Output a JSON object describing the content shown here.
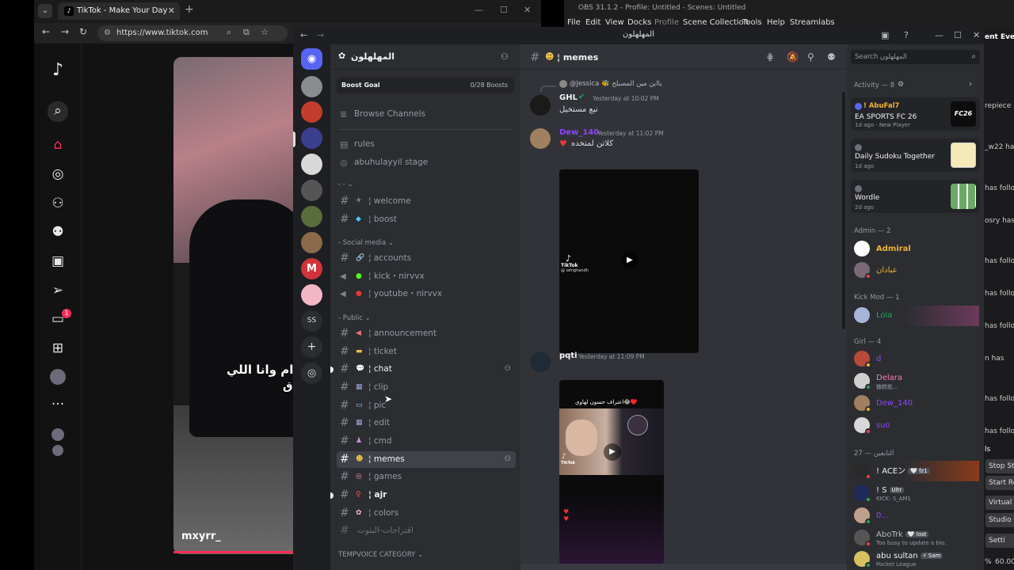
{
  "colors": {
    "tiktok_red": "#fe2c55",
    "discord_bg": "#313338",
    "discord_sidebar": "#2b2d31",
    "discord_dark": "#1e1f22",
    "selected_channel": "#404249",
    "admin_gold": "#f0b232",
    "kickmod_green": "#23a55a",
    "girl_pink": "#f47fb3",
    "purple": "#8e44ff"
  },
  "browser": {
    "tab_title": "TikTok - Make Your Day",
    "url": "https://www.tiktok.com",
    "tiktok": {
      "caption_line1": "يبقعد قدام وانا اللي",
      "caption_line2": "ق 😊😊",
      "username": "mxyrr_",
      "notification_count": "1"
    }
  },
  "obs": {
    "title": "OBS 31.1.2 - Profile: Untitled - Scenes: Untitled",
    "menu": [
      "File",
      "Edit",
      "View",
      "Docks",
      "Profile",
      "Scene Collection",
      "Tools",
      "Help",
      "Streamlabs"
    ],
    "right_texts": [
      "ent Even",
      "repiece h",
      "_w22 has",
      "has follo",
      "osry has",
      "has follo",
      "has follow",
      "has follo",
      "n has",
      "has followe",
      "has follo"
    ],
    "right_buttons": [
      "ls",
      "Stop Str",
      "Start Re",
      "Virtual C",
      "Studio",
      "Setti"
    ],
    "right_bottom": [
      "%",
      "60.00"
    ]
  },
  "discord": {
    "window_title": "المهلهلون",
    "guild": {
      "name": "المهلهلون",
      "boost_goal_label": "Boost Goal",
      "boost_goal_value": "0/28 Boosts"
    },
    "server_text_icon": "SS",
    "channels": {
      "browse": "Browse Channels",
      "rules": "rules",
      "stage": "abuhulayyil stage",
      "cat_dash": "- - ⌄",
      "welcome": "¦ welcome",
      "boost": "¦ boost",
      "cat_social": "- Social media ⌄",
      "accounts": "¦ accounts",
      "kick": "¦ kick・nirvvx",
      "youtube": "¦ youtube・nirvvx",
      "cat_public": "- Public ⌄",
      "announcement": "¦ announcement",
      "ticket": "¦ ticket",
      "chat": "¦ chat",
      "clip": "¦ clip",
      "pic": "¦ pic",
      "edit": "¦ edit",
      "cmd": "¦ cmd",
      "memes": "¦ memes",
      "games": "¦ games",
      "ajr": "¦ ajr",
      "colors": "¦ colors",
      "suggestions": "اقتراحات-البثوت",
      "cat_tempvoice": "TEMPVOICE CATEGORY ⌄"
    },
    "chat": {
      "channel_title": "¦ memes",
      "reply_header": "@Jessica 🐝 يااين مين المصيلح",
      "msg1_author": "GHL",
      "msg1_time": "Yesterday at 10:02 PM",
      "msg1_text": "نبع مستخيل",
      "msg2_author": "Dew_140",
      "msg2_time": "Yesterday at 11:02 PM",
      "msg2_text": "كلاتن لمتخده",
      "msg3_author": "pqti",
      "msg3_time": "Yesterday at 11:09 PM",
      "tiktok_watermark": "TikTok",
      "tiktok_handle": "@ iamghandh",
      "vid2_caption": "اعتراف حسون لهاوي😂♥️"
    },
    "members": {
      "search_placeholder": "Search المهلهلون",
      "activity_header": "Activity — 8",
      "activities": [
        {
          "user": "! AbuFal7",
          "title": "EA SPORTS FC 26",
          "sub": "1d ago  ·  New Player",
          "thumb": "FC26"
        },
        {
          "user": "",
          "title": "Daily Sudoku Together",
          "sub": "1d ago",
          "thumb": ""
        },
        {
          "user": "",
          "title": "Wordle",
          "sub": "2d ago",
          "thumb": ""
        }
      ],
      "roles": {
        "admin": "Admin — 2",
        "kickmod": "Kick Mod — 1",
        "girl": "Girl — 4",
        "followers": "التابعين — 27"
      },
      "admin_members": [
        "Admiral",
        "عبادان"
      ],
      "kickmod_members": [
        "Lola"
      ],
      "girl_members": [
        "d",
        "Delara",
        "Dew_140",
        "suo"
      ],
      "girl_sub": "糖糕乾...",
      "follower_members": [
        {
          "name": "! ACEン",
          "tag": "🤍 fz1",
          "sub": ""
        },
        {
          "name": "! S",
          "tag": "Ultr",
          "sub": "KICK: S_AM1"
        },
        {
          "name": "0...",
          "tag": "",
          "sub": ""
        },
        {
          "name": "AboTrk",
          "tag": "🤍 lost",
          "sub": "Too busy to update a bio."
        },
        {
          "name": "abu sultan",
          "tag": "⚡ Sam",
          "sub": "Pocket League"
        }
      ]
    }
  }
}
